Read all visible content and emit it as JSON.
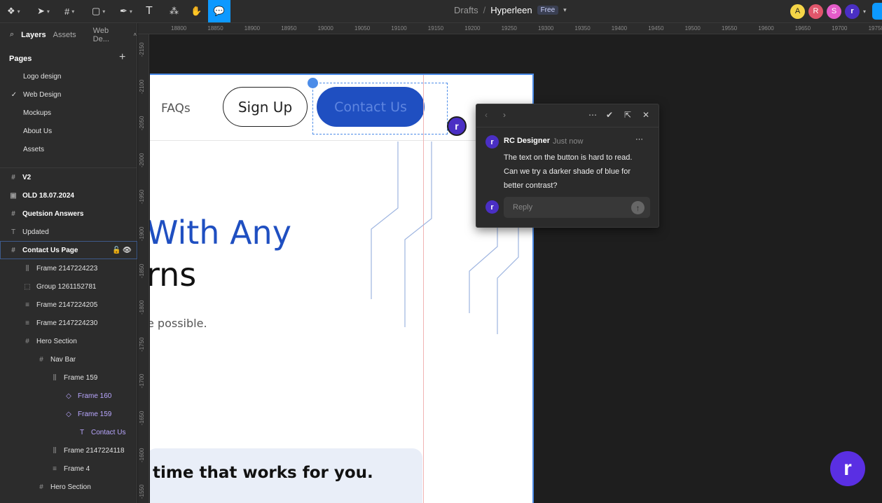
{
  "toolbar": {
    "tools": [
      "main-menu",
      "move",
      "frame",
      "shape",
      "pen",
      "text",
      "resources",
      "hand",
      "comment"
    ]
  },
  "breadcrumb": {
    "folder": "Drafts",
    "separator": "/",
    "file": "Hyperleen",
    "plan": "Free"
  },
  "collaborators": [
    "A",
    "R",
    "S",
    "r"
  ],
  "panel": {
    "tab_layers": "Layers",
    "tab_assets": "Assets",
    "page_picker": "Web De...",
    "pages_title": "Pages",
    "pages": [
      {
        "label": "Logo design",
        "current": false
      },
      {
        "label": "Web Design",
        "current": true
      },
      {
        "label": "Mockups",
        "current": false
      },
      {
        "label": "About Us",
        "current": false
      },
      {
        "label": "Assets",
        "current": false
      }
    ],
    "layers": [
      {
        "label": "V2",
        "icon": "#"
      },
      {
        "label": "OLD 18.07.2024",
        "icon": "▣"
      },
      {
        "label": "Quetsion Answers",
        "icon": "#"
      },
      {
        "label": "Updated",
        "icon": "T"
      },
      {
        "label": "Contact Us Page",
        "icon": "#"
      },
      {
        "label": "Frame 2147224223",
        "icon": "⫼"
      },
      {
        "label": "Group 1261152781",
        "icon": "⬚"
      },
      {
        "label": "Frame 2147224205",
        "icon": "≡"
      },
      {
        "label": "Frame 2147224230",
        "icon": "≡"
      },
      {
        "label": "Hero Section",
        "icon": "#"
      },
      {
        "label": "Nav Bar",
        "icon": "#"
      },
      {
        "label": "Frame 159",
        "icon": "⫼"
      },
      {
        "label": "Frame 160",
        "icon": "◇"
      },
      {
        "label": "Frame 159",
        "icon": "◇"
      },
      {
        "label": "Contact Us",
        "icon": "T"
      },
      {
        "label": "Frame 2147224118",
        "icon": "⫼"
      },
      {
        "label": "Frame 4",
        "icon": "≡"
      },
      {
        "label": "Hero Section",
        "icon": "#"
      }
    ]
  },
  "ruler_x": [
    "18800",
    "18850",
    "18900",
    "18950",
    "19000",
    "19050",
    "19100",
    "19150",
    "19200",
    "19250",
    "19300",
    "19350",
    "19400",
    "19450",
    "19500",
    "19550",
    "19600",
    "19650",
    "19700",
    "19750"
  ],
  "ruler_y": [
    "-2150",
    "-2100",
    "-2050",
    "-2000",
    "-1950",
    "-1900",
    "-1850",
    "-1800",
    "-1750",
    "-1700",
    "-1650",
    "-1600",
    "-1550"
  ],
  "design": {
    "faqs": "FAQs",
    "signup": "Sign Up",
    "contact": "Contact Us",
    "headline_1": "With Any",
    "headline_2": "rns",
    "subtext": "e possible.",
    "card_text": "time that works for you."
  },
  "comment": {
    "author": "RC Designer",
    "time": "Just now",
    "body": "The text on the button is hard to read. Can we try a darker shade of blue for better contrast?",
    "reply_placeholder": "Reply"
  },
  "colors": {
    "accent": "#0d99ff",
    "brand_blue": "#1f4fc1",
    "avatar_purple": "#4a2fc4"
  }
}
